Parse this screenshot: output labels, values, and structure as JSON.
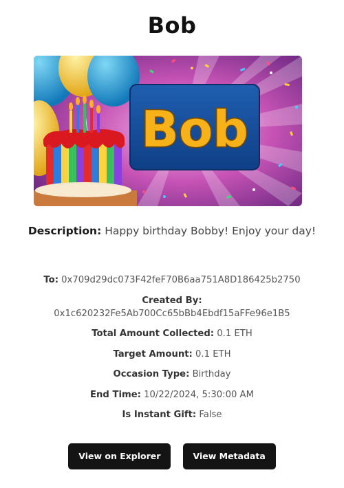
{
  "gift": {
    "title": "Bob",
    "banner_text": "Bob",
    "description_label": "Description:",
    "description": "Happy birthday Bobby! Enjoy your day!",
    "details": [
      {
        "label": "To:",
        "value": "0x709d29dc073F42feF70B6aa751A8D186425b2750"
      },
      {
        "label": "Created By:",
        "value": "0x1c620232Fe5Ab700Cc65bBb4Ebdf15aFFe96e1B5"
      },
      {
        "label": "Total Amount Collected:",
        "value": "0.1 ETH"
      },
      {
        "label": "Target Amount:",
        "value": "0.1 ETH"
      },
      {
        "label": "Occasion Type:",
        "value": "Birthday"
      },
      {
        "label": "End Time:",
        "value": "10/22/2024, 5:30:00 AM"
      },
      {
        "label": "Is Instant Gift:",
        "value": "False"
      }
    ]
  },
  "actions": {
    "explorer_label": "View on Explorer",
    "metadata_label": "View Metadata"
  }
}
